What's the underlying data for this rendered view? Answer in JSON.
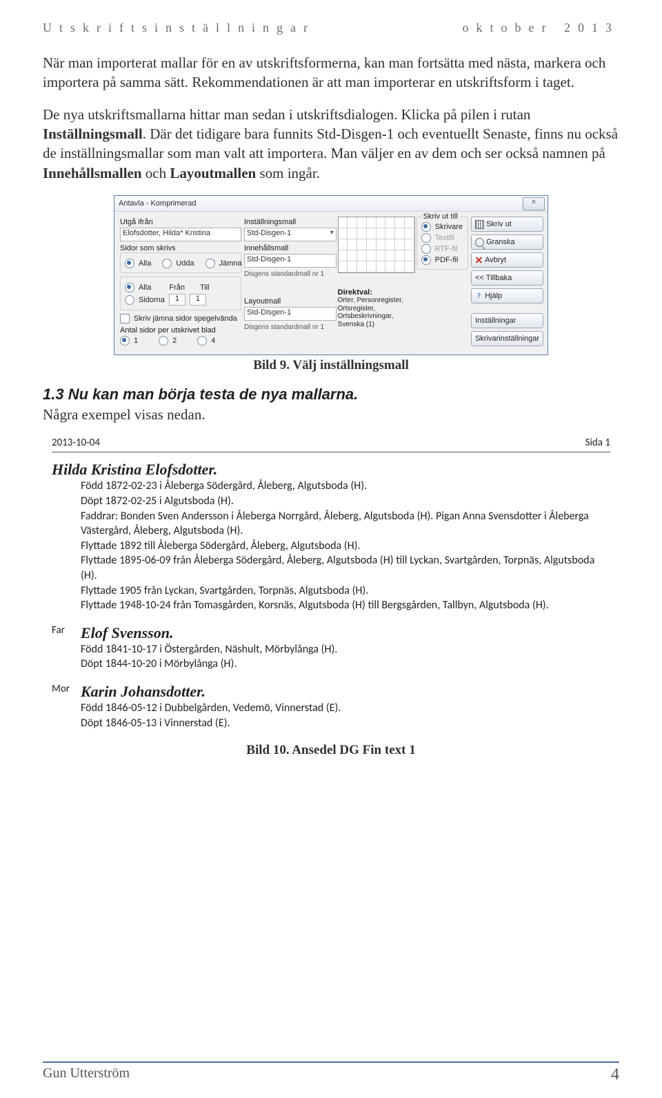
{
  "header": {
    "left": "Utskriftsinställningar",
    "right": "oktober 2013"
  },
  "body": {
    "p1a": "När man importerat mallar för en av utskriftsformerna, kan man fortsätta med nästa, markera och importera på samma sätt. Rekommendationen är att man importerar en utskriftsform i taget.",
    "p2a": "De nya utskriftsmallarna hittar man sedan i utskriftsdialogen. Klicka på pilen i rutan ",
    "p2b": "Inställningsmall",
    "p2c": ". Där det tidigare bara funnits Std-Disgen-1 och eventuellt Senaste, finns nu också de inställningsmallar som man valt att importera. Man väljer en av dem och ser också namnen på ",
    "p2d": "Innehållsmallen",
    "p2e": " och ",
    "p2f": "Layoutmallen",
    "p2g": " som ingår."
  },
  "dialog": {
    "title": "Antavla - Komprimerad",
    "col1": {
      "utga_lbl": "Utgå ifrån",
      "utga_val": "Elofsdotter, Hilda* Kristina",
      "sidor_lbl": "Sidor som skrivs",
      "sidor_alla": "Alla",
      "sidor_udda": "Udda",
      "sidor_jamna": "Jämna",
      "alla2": "Alla",
      "fran": "Från",
      "till": "Till",
      "sidorna": "Sidorna",
      "spin_from": "1",
      "spin_to": "1",
      "chk_spegel": "Skriv jämna sidor spegelvända",
      "antal_lbl": "Antal sidor per utskrivet blad",
      "r1": "1",
      "r2": "2",
      "r4": "4"
    },
    "col2": {
      "inst_lbl": "Inställningsmall",
      "inst_val": "Std-Disgen-1",
      "inne_lbl": "Innehållsmall",
      "inne_val": "Std-Disgen-1",
      "inne_sub": "Disgens standardmall nr 1",
      "layout_lbl": "Layoutmall",
      "layout_val": "Std-Disgen-1",
      "layout_sub": "Disgens standardmall nr 1"
    },
    "col3": {
      "direkt_lbl": "Direktval:",
      "direkt_val": "Orter, Personregister, Ortsregister, Ortsbeskrivningar, Svenska (1)"
    },
    "col4": {
      "skrivut_lbl": "Skriv ut till",
      "r_skrivare": "Skrivare",
      "r_textfil": "Textfil",
      "r_rtf": "RTF-fil",
      "r_pdf": "PDF-fil"
    },
    "col5": {
      "b_skrivut": "Skriv ut",
      "b_granska": "Granska",
      "b_avbryt": "Avbryt",
      "b_tillbaka": "<< Tillbaka",
      "b_hjalp": "Hjälp",
      "b_inst": "Inställningar",
      "b_skrivarinst": "Skrivarinställningar"
    }
  },
  "caption1": "Bild 9. Välj inställningsmall",
  "section_1_3": "1.3  Nu kan man börja testa de nya mallarna.",
  "section_1_3_sub": "Några exempel visas nedan.",
  "report": {
    "date": "2013-10-04",
    "sida": "Sida 1",
    "name1": "Hilda Kristina Elofsdotter.",
    "lines1": [
      "Född 1872-02-23 i  Åleberga Södergård, Åleberg, Algutsboda (H).",
      "Döpt 1872-02-25 i Algutsboda (H).",
      "Faddrar: Bonden Sven Andersson i  Åleberga Norrgård, Åleberg, Algutsboda (H). Pigan Anna Svensdotter i  Åleberga Västergård, Åleberg, Algutsboda (H).",
      "Flyttade 1892 till Åleberga Södergård, Åleberg, Algutsboda (H).",
      "Flyttade 1895-06-09 från Åleberga Södergård, Åleberg, Algutsboda (H) till Lyckan, Svartgården, Torpnäs, Algutsboda (H).",
      "Flyttade 1905 från Lyckan, Svartgården, Torpnäs, Algutsboda (H).",
      "Flyttade 1948-10-24 från Tomasgården, Korsnäs, Algutsboda (H) till Bergsgården, Tallbyn, Algutsboda (H)."
    ],
    "far": "Far",
    "name2": "Elof Svensson.",
    "lines2": [
      "Född 1841-10-17 i  Östergården, Näshult, Mörbylånga (H).",
      "Döpt 1844-10-20 i  Mörbylånga (H)."
    ],
    "mor": "Mor",
    "name3": "Karin Johansdotter.",
    "lines3": [
      "Född 1846-05-12 i  Dubbelgården, Vedemö, Vinnerstad (E).",
      "Döpt 1846-05-13 i  Vinnerstad (E)."
    ]
  },
  "caption2": "Bild 10. Ansedel DG Fin text 1",
  "footer": {
    "author": "Gun Utterström",
    "page": "4"
  }
}
